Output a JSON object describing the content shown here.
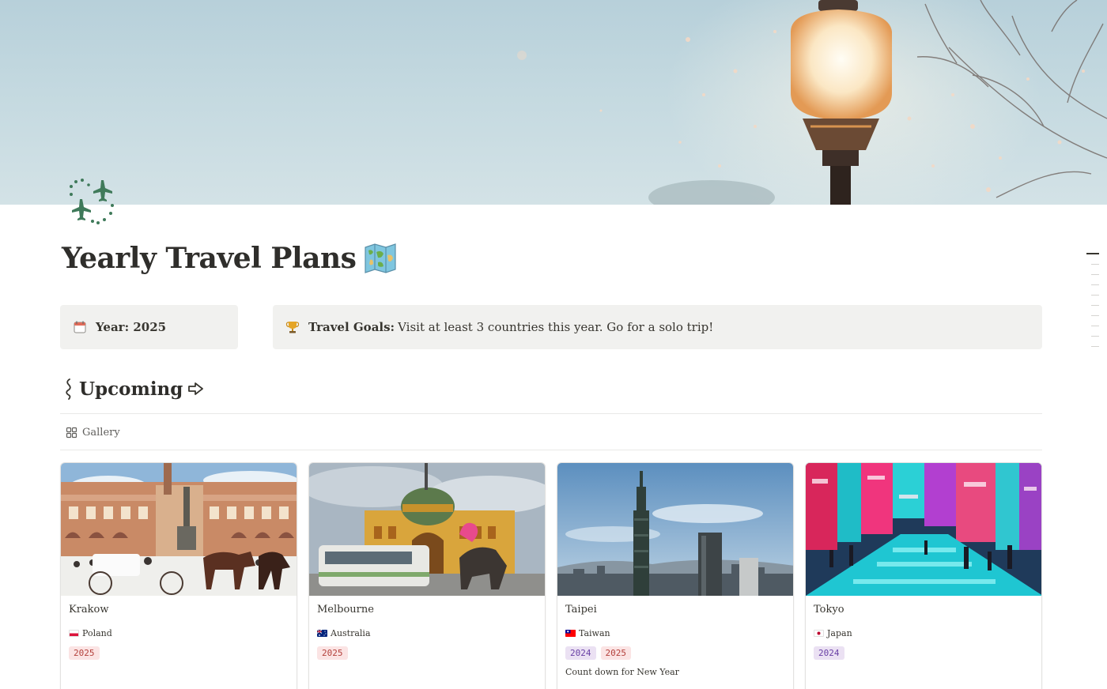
{
  "page": {
    "title": "Yearly Travel Plans",
    "icon": "airplanes-icon",
    "title_emoji": "world-map-icon"
  },
  "callouts": {
    "year": {
      "icon": "calendar-icon",
      "label": "Year: 2025"
    },
    "goals": {
      "icon": "trophy-icon",
      "label": "Travel Goals:",
      "text": "Visit at least 3 countries this year. Go for a solo trip!"
    }
  },
  "section": {
    "heading": "Upcoming",
    "heading_icon_left": "squiggle-icon",
    "heading_icon_right": "arrow-right-icon",
    "view_label": "Gallery",
    "view_icon": "gallery-grid-icon"
  },
  "cards": [
    {
      "name": "Krakow",
      "country": "Poland",
      "flag": "poland-flag-icon",
      "tags": [
        {
          "label": "2025",
          "color": "red"
        }
      ],
      "note": ""
    },
    {
      "name": "Melbourne",
      "country": "Australia",
      "flag": "australia-flag-icon",
      "tags": [
        {
          "label": "2025",
          "color": "red"
        }
      ],
      "note": ""
    },
    {
      "name": "Taipei",
      "country": "Taiwan",
      "flag": "taiwan-flag-icon",
      "tags": [
        {
          "label": "2024",
          "color": "purple"
        },
        {
          "label": "2025",
          "color": "red"
        }
      ],
      "note": "Count down for New Year"
    },
    {
      "name": "Tokyo",
      "country": "Japan",
      "flag": "japan-flag-icon",
      "tags": [
        {
          "label": "2024",
          "color": "purple"
        }
      ],
      "note": ""
    }
  ],
  "colors": {
    "tag_red_bg": "#fbe4e4",
    "tag_red_text": "#b4413c",
    "tag_purple_bg": "#ebe1f3",
    "tag_purple_text": "#6940a5",
    "callout_bg": "#f1f1ef",
    "icon_green": "#3f7a5a"
  }
}
